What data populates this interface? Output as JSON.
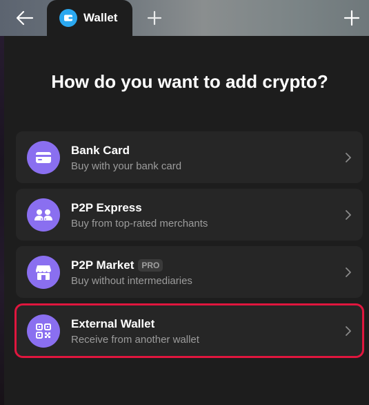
{
  "tabbar": {
    "tab_label": "Wallet",
    "back_icon": "arrow-left-icon",
    "new_tab_icon": "plus-icon",
    "corner_icon": "corner-cross-icon"
  },
  "page": {
    "heading": "How do you want to add crypto?"
  },
  "options": [
    {
      "title": "Bank Card",
      "subtitle": "Buy with your bank card",
      "icon": "credit-card-icon"
    },
    {
      "title": "P2P Express",
      "subtitle": "Buy from top-rated merchants",
      "icon": "users-icon"
    },
    {
      "title": "P2P Market",
      "badge": "PRO",
      "subtitle": "Buy without intermediaries",
      "icon": "store-icon"
    },
    {
      "title": "External Wallet",
      "subtitle": "Receive from another wallet",
      "icon": "qr-code-icon"
    }
  ],
  "colors": {
    "accent": "#8a6ff0",
    "tab_icon": "#2ba8f0",
    "highlight": "#e0163e"
  }
}
